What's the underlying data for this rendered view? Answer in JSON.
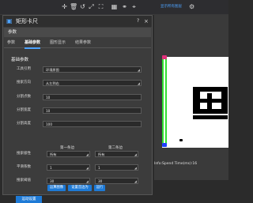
{
  "toolbar": {
    "icons": [
      "crosshair-icon",
      "trash-icon",
      "reset-icon",
      "expand-icon",
      "fullscreen-icon",
      "grid-icon",
      "link-icon",
      "target-icon"
    ],
    "select_label": "显示所有图层",
    "gear_icon": "gear-icon"
  },
  "dialog": {
    "title": "矩形卡尺",
    "help": "?",
    "close": "×",
    "section": "参数",
    "tabs": [
      "参数",
      "基础参数",
      "图形显示",
      "结果参数"
    ],
    "group_title": "基础参数",
    "fields": [
      {
        "label": "工具引用",
        "value": "环境原图",
        "type": "dropdown"
      },
      {
        "label": "搜索方向",
        "value": "从左到右",
        "type": "dropdown"
      },
      {
        "label": "分割点数",
        "value": "10",
        "type": "input"
      },
      {
        "label": "分割宽度",
        "value": "10",
        "type": "input"
      },
      {
        "label": "分割高度",
        "value": "100",
        "type": "input"
      }
    ],
    "col_heads": [
      "第一条边",
      "第二条边"
    ],
    "pair_fields": [
      {
        "label": "搜索极性",
        "first": "所有",
        "second": "所有"
      },
      {
        "label": "平滑系数",
        "first": "1",
        "second": "1"
      },
      {
        "label": "搜索阈值",
        "first": "30",
        "second": "30"
      }
    ],
    "buttons": [
      "运算图像",
      "设置首边为",
      "运行"
    ]
  },
  "status": {
    "text": "Info:Spend Time(ms):16"
  },
  "bottom_tab": "运动设置",
  "colors": {
    "accent": "#1e7ad6",
    "edge_line": "#2fe02f",
    "handle_top": "#e0307a",
    "handle_bottom": "#1f3fff"
  }
}
